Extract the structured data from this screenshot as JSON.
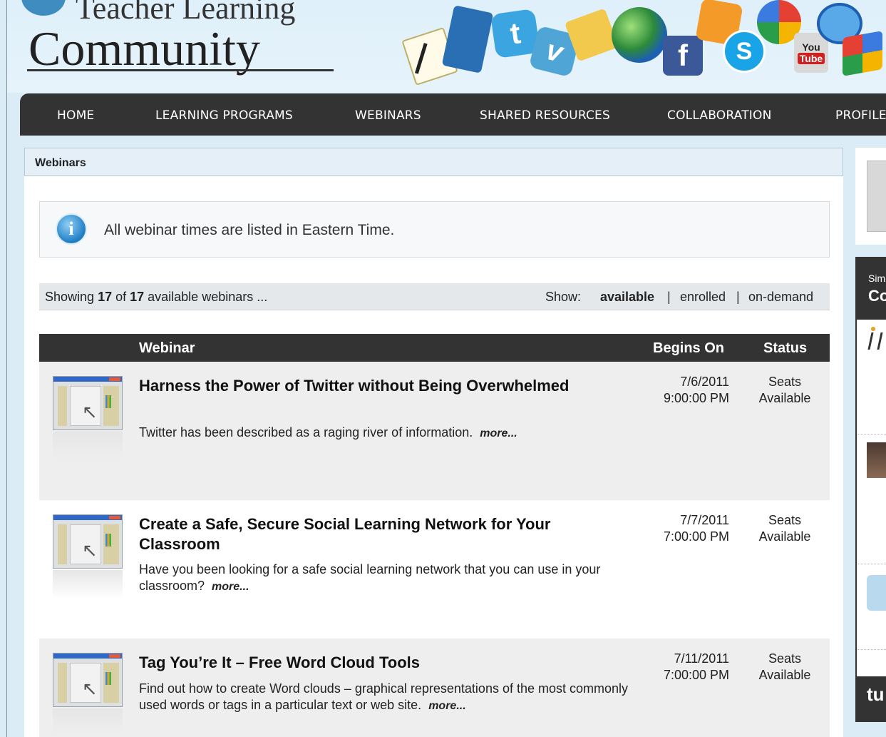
{
  "header": {
    "logo_line1": "Teacher Learning",
    "logo_line2": "Community",
    "icons": [
      "pencil-notepad-icon",
      "notebook-icon",
      "twitter-icon",
      "vimeo-icon",
      "folder-icon",
      "globe-icon",
      "facebook-icon",
      "rss-icon",
      "skype-icon",
      "google-icon",
      "youtube-icon",
      "chat-icon",
      "windows-icon"
    ],
    "icon_glyphs": {
      "twitter": "t",
      "vimeo": "v",
      "facebook": "f",
      "skype": "S",
      "youtube_top": "You",
      "youtube_bottom": "Tube"
    }
  },
  "nav": {
    "items": [
      "HOME",
      "LEARNING PROGRAMS",
      "WEBINARS",
      "SHARED RESOURCES",
      "COLLABORATION",
      "PROFILE"
    ]
  },
  "main": {
    "title": "Webinars",
    "notice": "All webinar times are listed in Eastern Time.",
    "showing_prefix": "Showing ",
    "showing_count": "17",
    "showing_of": " of ",
    "showing_total": "17",
    "showing_suffix": " available webinars ...",
    "show_label": "Show:",
    "filters": [
      "available",
      "enrolled",
      "on-demand"
    ],
    "active_filter": "available",
    "separator": "|",
    "columns": [
      "Webinar",
      "Begins On",
      "Status"
    ],
    "rows": [
      {
        "title": "Harness the Power of Twitter without Being Overwhelmed",
        "description": "Twitter has been described as a raging river of information.",
        "more": "more...",
        "date": "7/6/2011",
        "time": "9:00:00 PM",
        "status_line1": "Seats",
        "status_line2": "Available"
      },
      {
        "title": "Create a Safe, Secure Social Learning Network for Your Classroom",
        "description": "Have you been looking for a safe social learning network that you can use in your classroom?",
        "more": "more...",
        "date": "7/7/2011",
        "time": "7:00:00 PM",
        "status_line1": "Seats",
        "status_line2": "Available"
      },
      {
        "title": "Tag You’re It – Free Word Cloud Tools",
        "description": "Find out how to create Word clouds – graphical representations of the most commonly used words or tags in a particular text or web site.",
        "more": "more...",
        "date": "7/11/2011",
        "time": "7:00:00 PM",
        "status_line1": "Seats",
        "status_line2": "Available"
      }
    ]
  },
  "sidebar": {
    "sub_heading": "Sim",
    "heading": "Co",
    "footer_text": "tu"
  },
  "colors": {
    "nav_bg": "#333333",
    "page_bg": "#dcecf6",
    "title_bar_bg": "#e4eff7",
    "row_shade": "#eeeeee"
  }
}
